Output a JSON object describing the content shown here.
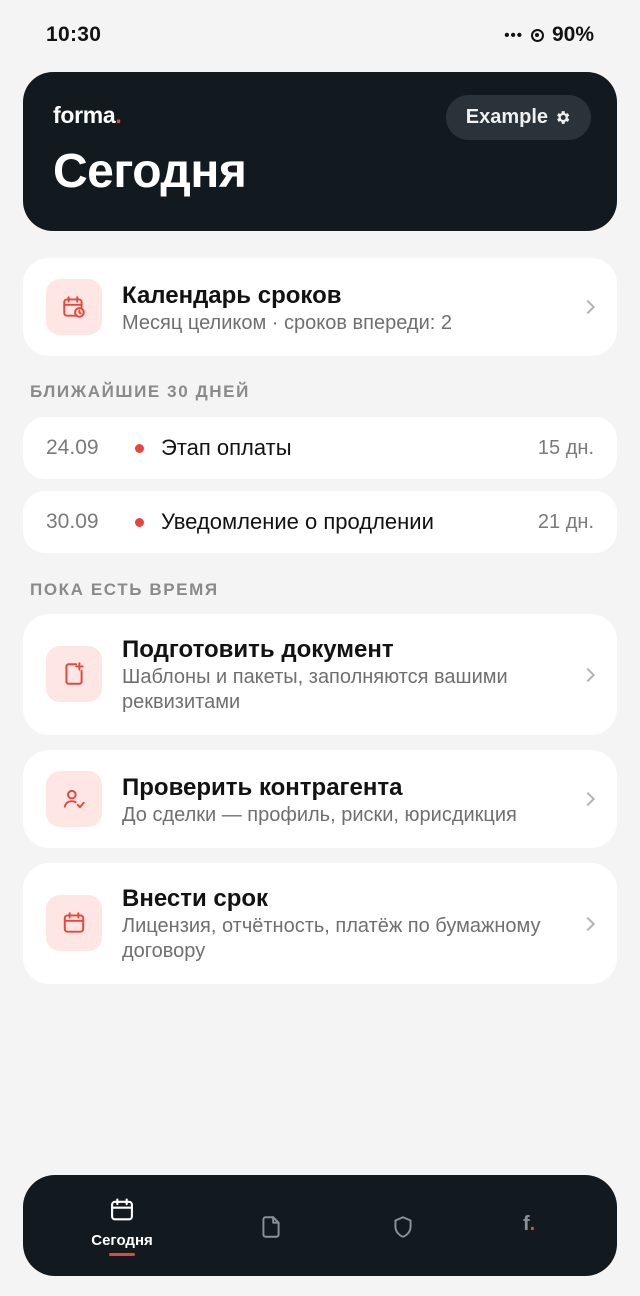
{
  "status_bar": {
    "time": "10:30",
    "dots": "•••",
    "battery": "90%"
  },
  "header": {
    "brand": "forma",
    "brand_dot": ".",
    "title": "Сегодня",
    "account_label": "Example",
    "account_icon": "gear-icon"
  },
  "calendar_card": {
    "title": "Календарь сроков",
    "subtitle": "Месяц целиком · сроков впереди: 2",
    "icon": "calendar-clock-icon"
  },
  "upcoming": {
    "label": "БЛИЖАЙШИЕ 30 ДНЕЙ",
    "items": [
      {
        "date": "24.09",
        "title": "Этап оплаты",
        "days": "15 дн."
      },
      {
        "date": "30.09",
        "title": "Уведомление о продлении",
        "days": "21 дн."
      }
    ],
    "dot_color": "#e8463c"
  },
  "actions": {
    "label": "ПОКА ЕСТЬ ВРЕМЯ",
    "items": [
      {
        "title": "Подготовить документ",
        "subtitle": "Шаблоны и пакеты, заполняются вашими реквизитами",
        "icon": "document-plus-icon"
      },
      {
        "title": "Проверить контрагента",
        "subtitle": "До сделки — профиль, риски, юрисдикция",
        "icon": "user-check-icon"
      },
      {
        "title": "Внести срок",
        "subtitle": "Лицензия, отчётность, платёж по бумажному договору",
        "icon": "calendar-icon"
      }
    ]
  },
  "bottom_nav": {
    "items": [
      {
        "label": "Сегодня",
        "icon": "calendar-icon",
        "active": true
      },
      {
        "label": "",
        "icon": "document-icon",
        "active": false
      },
      {
        "label": "",
        "icon": "shield-icon",
        "active": false
      },
      {
        "label": "f",
        "icon": "forma-logo-icon",
        "active": false
      }
    ],
    "f_dot": "."
  },
  "colors": {
    "accent": "#e8463c",
    "dark": "#121a20",
    "icon_bg": "#fde6e3",
    "background": "#f4f4f4"
  }
}
